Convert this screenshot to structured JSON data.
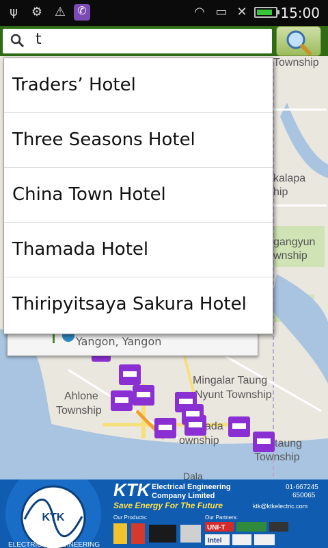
{
  "status_bar": {
    "time": "15:00",
    "battery_level": 0.85
  },
  "search": {
    "query": "t",
    "button_icon": "magnifier-icon"
  },
  "suggestions": [
    {
      "label": "Traders’ Hotel"
    },
    {
      "label": "Three Seasons Hotel"
    },
    {
      "label": "China Town Hotel"
    },
    {
      "label": "Thamada Hotel"
    },
    {
      "label": "Thiripyitsaya Sakura Hotel"
    }
  ],
  "map": {
    "labels": {
      "township_top": "Township",
      "kalapa_1": "kalapa",
      "kalapa_2": "hip",
      "gangyun_1": "gangyun",
      "gangyun_2": "wnship",
      "mingalar_1": "Mingalar Taung",
      "mingalar_2": "Nyunt Township",
      "ahlone_1": "Ahlone",
      "ahlone_2": "Township",
      "pabedan_1": "ada",
      "pabedan_2": "ownship",
      "botahtaung_1": "Bo  taung",
      "botahtaung_2": "Township",
      "dala": "Dala"
    },
    "info_text": "Yangon, Yangon"
  },
  "ad": {
    "brand": "KTK",
    "line1": "Electrical Engineering",
    "line2": "Company Limited",
    "tagline": "Save Energy For The Future",
    "phone1": "01-667245",
    "phone2": "650065",
    "email": "ktk@ktkelectric.com",
    "products_label": "Our Products:",
    "partners_label": "Our Partners:",
    "circle_text": "ELECTRICAL ENGINEERING",
    "partner1": "UNI-T",
    "partner2": "Intel"
  },
  "colors": {
    "search_bg": "#2e6b14",
    "water": "#a8c4e0",
    "road": "#f7df7a",
    "hotel_marker": "#8a2fd1",
    "ad_bg": "#0f5cb0"
  }
}
